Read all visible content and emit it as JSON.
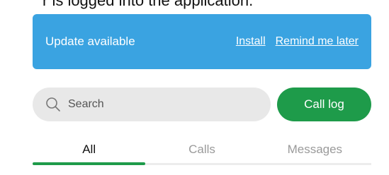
{
  "caption": "r is logged into the application.",
  "update_banner": {
    "message": "Update available",
    "install_label": "Install",
    "remind_label": "Remind me later"
  },
  "search": {
    "placeholder": "Search"
  },
  "call_log_button": {
    "label": "Call log"
  },
  "tabs": [
    {
      "label": "All",
      "active": true
    },
    {
      "label": "Calls",
      "active": false
    },
    {
      "label": "Messages",
      "active": false
    }
  ],
  "colors": {
    "banner": "#3aa3e1",
    "accent_green": "#1e9b4a",
    "search_bg": "#e8e8e8"
  },
  "icons": {
    "search": "search-icon"
  }
}
